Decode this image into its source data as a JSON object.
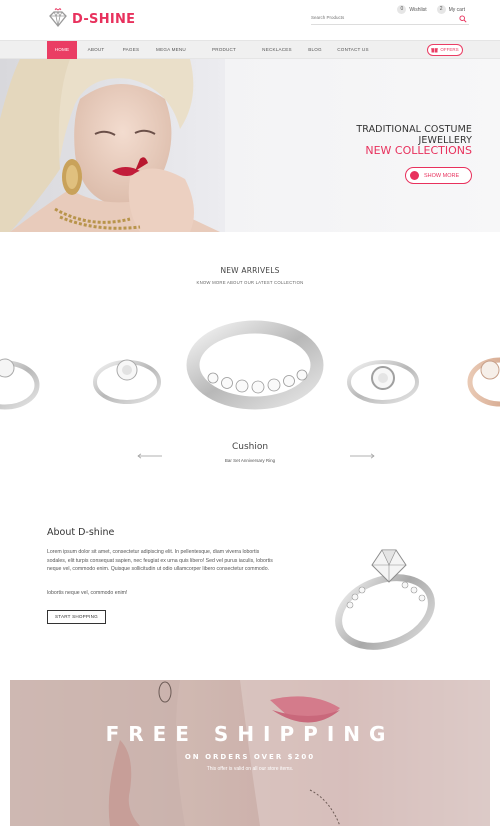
{
  "brand": {
    "name": "D-SHINE",
    "accent": "#e8315d"
  },
  "header": {
    "wishlist": {
      "count": "0",
      "label": "Wishlist"
    },
    "cart": {
      "count": "2",
      "label": "My cart"
    },
    "search_placeholder": "Search Products"
  },
  "nav": {
    "items": [
      "HOME",
      "ABOUT",
      "PAGES",
      "MEGA MENU",
      "PRODUCT CATEGORY",
      "NECKLACES",
      "BLOG",
      "CONTACT US"
    ],
    "active": "HOME",
    "offers_label": "OFFERS"
  },
  "hero": {
    "line1": "TRADITIONAL COSTUME JEWELLERY",
    "line2": "NEW COLLECTIONS",
    "button": "SHOW MORE"
  },
  "arrivals": {
    "title": "NEW ARRIVELS",
    "subtitle": "KNOW MORE ABOUT OUR LATEST COLLECTION",
    "featured_name": "Cushion",
    "featured_sub": "Bar Set Anniversary Ring"
  },
  "about": {
    "title": "About D-shine",
    "text": "Lorem ipsum dolor sit amet, consectetur adipiscing elit. In pellentesque, diam viverra lobortis sodales, elit turpis consequat sapien, nec feugiat ex urna quis libero! Sed vel purus iaculis, lobortis neque vel, commodo enim. Quisque sollicitudin ut odio ullamcorper libero consectetur commodo.",
    "text2": "lobortis neque vel, commodo enim!",
    "button": "START SHOPPING"
  },
  "banner": {
    "headline": "FREE SHIPPING",
    "subline": "ON ORDERS OVER $200",
    "note": "This offer is valid on all our store items."
  }
}
